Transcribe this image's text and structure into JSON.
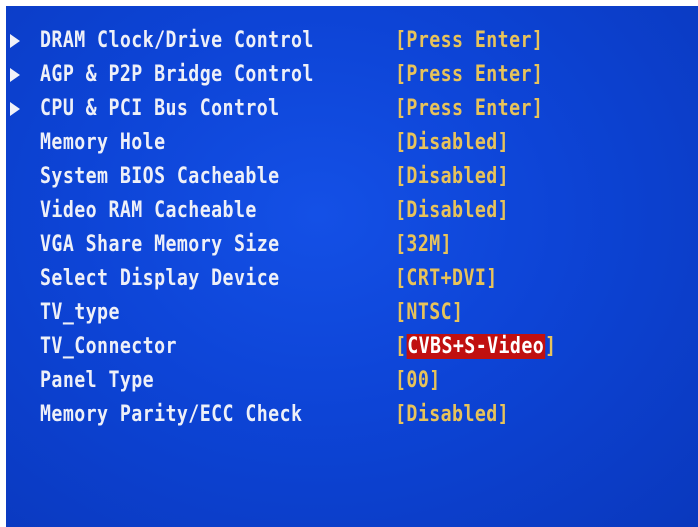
{
  "colors": {
    "background": "#0d44d6",
    "label": "#eef0f8",
    "value": "#e8c35a",
    "highlight_bg": "#c01010",
    "highlight_text": "#ffffff"
  },
  "items": [
    {
      "label": "DRAM Clock/Drive Control",
      "value_open": "[",
      "value": "Press Enter",
      "value_close": "]",
      "submenu": true,
      "icon": "submenu-arrow-icon"
    },
    {
      "label": "AGP & P2P Bridge Control",
      "value_open": "[",
      "value": "Press Enter",
      "value_close": "]",
      "submenu": true,
      "icon": "submenu-arrow-icon"
    },
    {
      "label": "CPU & PCI Bus Control",
      "value_open": "[",
      "value": "Press Enter",
      "value_close": "]",
      "submenu": true,
      "icon": "submenu-arrow-icon"
    },
    {
      "label": "Memory Hole",
      "value_open": "[",
      "value": "Disabled",
      "value_close": "]"
    },
    {
      "label": "System BIOS Cacheable",
      "value_open": "[",
      "value": "Disabled",
      "value_close": "]"
    },
    {
      "label": "Video RAM Cacheable",
      "value_open": "[",
      "value": "Disabled",
      "value_close": "]"
    },
    {
      "label": "VGA Share Memory Size",
      "value_open": "[",
      "value": "32M",
      "value_close": "]"
    },
    {
      "label": "Select Display Device",
      "value_open": "[",
      "value": "CRT+DVI",
      "value_close": "]"
    },
    {
      "label": "TV_type",
      "value_open": "[",
      "value": "NTSC",
      "value_close": "]"
    },
    {
      "label": "TV_Connector",
      "value_open": "[",
      "value": "CVBS+S-Video",
      "value_close": "]",
      "selected": true
    },
    {
      "label": "Panel Type",
      "value_open": "[",
      "value": "00",
      "value_close": "]"
    },
    {
      "label": "Memory Parity/ECC Check",
      "value_open": "[",
      "value": "Disabled",
      "value_close": "]"
    }
  ]
}
